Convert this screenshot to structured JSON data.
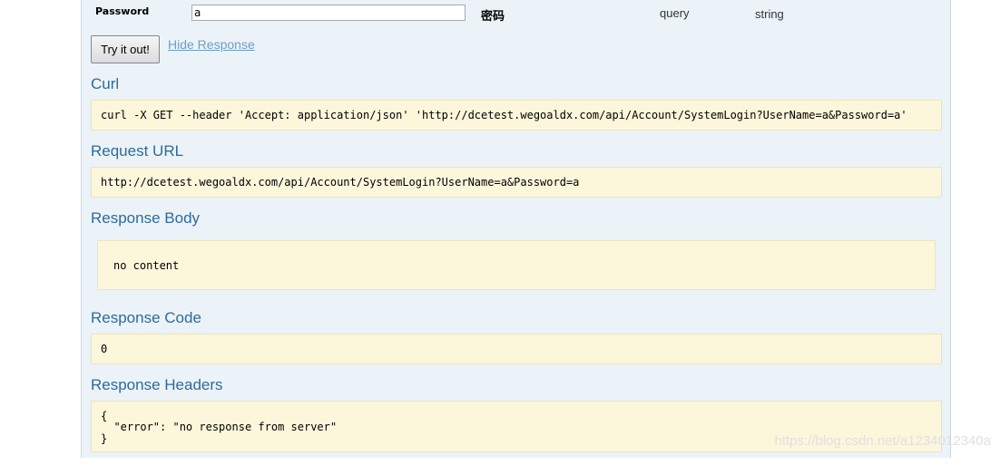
{
  "param": {
    "name": "Password",
    "value": "a",
    "description": "密码",
    "param_type": "query",
    "data_type": "string"
  },
  "actions": {
    "try_label": "Try it out!",
    "hide_label": "Hide Response"
  },
  "curl": {
    "title": "Curl",
    "command": "curl -X GET --header 'Accept: application/json' 'http://dcetest.wegoaldx.com/api/Account/SystemLogin?UserName=a&Password=a'"
  },
  "request_url": {
    "title": "Request URL",
    "url": "http://dcetest.wegoaldx.com/api/Account/SystemLogin?UserName=a&Password=a"
  },
  "response_body": {
    "title": "Response Body",
    "content": "no content"
  },
  "response_code": {
    "title": "Response Code",
    "code": "0"
  },
  "response_headers": {
    "title": "Response Headers",
    "line1": "{",
    "line2": "  \"error\": \"no response from server\"",
    "line3": "}"
  },
  "watermark": "https://blog.csdn.net/a1234012340a"
}
